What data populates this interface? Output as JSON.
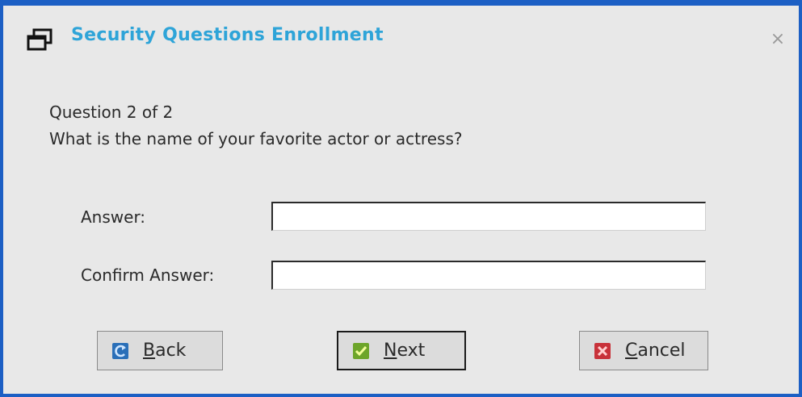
{
  "window": {
    "title": "Security Questions Enrollment",
    "close_glyph": "×",
    "icons": {
      "app": "window-icon",
      "close": "close-icon"
    }
  },
  "question": {
    "progress": "Question 2 of 2",
    "text": "What is the name of your favorite actor or actress?"
  },
  "form": {
    "answer_label": "Answer:",
    "answer_value": "",
    "confirm_label": "Confirm Answer:",
    "confirm_value": ""
  },
  "buttons": {
    "back": {
      "mnemonic": "B",
      "rest": "ack",
      "icon": "back-icon"
    },
    "next": {
      "mnemonic": "N",
      "rest": "ext",
      "icon": "check-icon"
    },
    "cancel": {
      "mnemonic": "C",
      "rest": "ancel",
      "icon": "cancel-icon"
    }
  },
  "colors": {
    "frame": "#1c5fc4",
    "title": "#2ea4d8",
    "background": "#e8e8e8"
  }
}
